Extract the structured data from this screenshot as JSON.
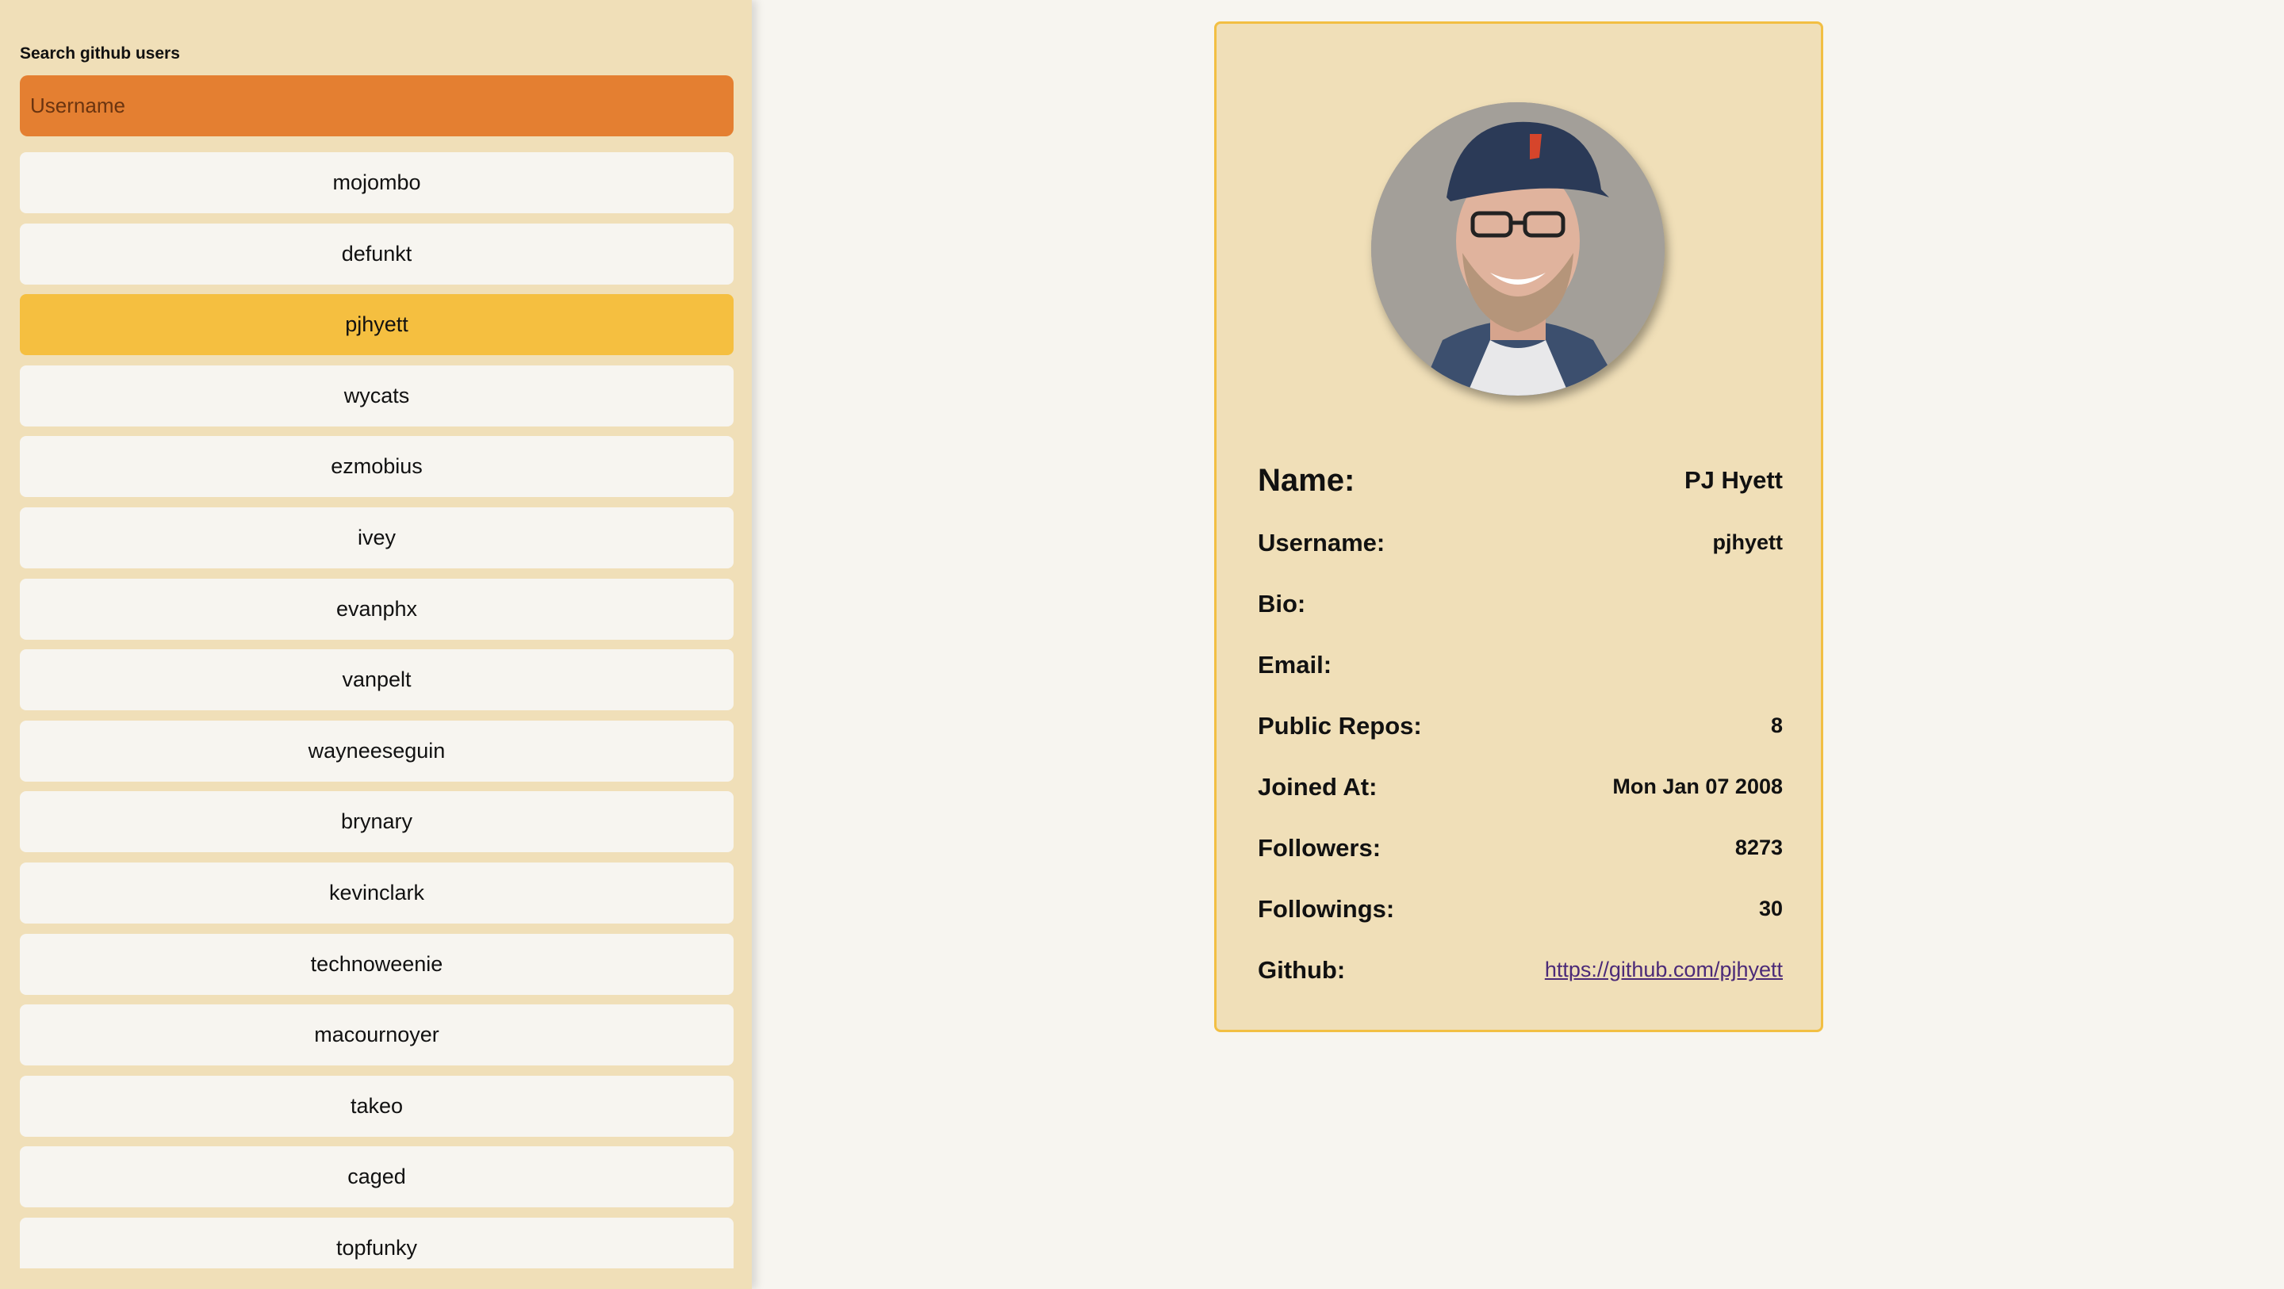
{
  "search": {
    "label": "Search github users",
    "placeholder": "Username",
    "value": ""
  },
  "users": [
    "mojombo",
    "defunkt",
    "pjhyett",
    "wycats",
    "ezmobius",
    "ivey",
    "evanphx",
    "vanpelt",
    "wayneeseguin",
    "brynary",
    "kevinclark",
    "technoweenie",
    "macournoyer",
    "takeo",
    "caged",
    "topfunky"
  ],
  "selected_user": "pjhyett",
  "profile": {
    "name_label": "Name:",
    "name": "PJ Hyett",
    "username_label": "Username:",
    "username": "pjhyett",
    "bio_label": "Bio:",
    "bio": "",
    "email_label": "Email:",
    "email": "",
    "repos_label": "Public Repos:",
    "repos": "8",
    "joined_label": "Joined At:",
    "joined": "Mon Jan 07 2008",
    "followers_label": "Followers:",
    "followers": "8273",
    "followings_label": "Followings:",
    "followings": "30",
    "github_label": "Github:",
    "github": "https://github.com/pjhyett"
  },
  "colors": {
    "sidebar_bg": "#f0dfb8",
    "search_bg": "#e47f31",
    "selected_bg": "#f5bf40",
    "page_bg": "#f7f5f0",
    "card_border": "#f2bf43"
  }
}
